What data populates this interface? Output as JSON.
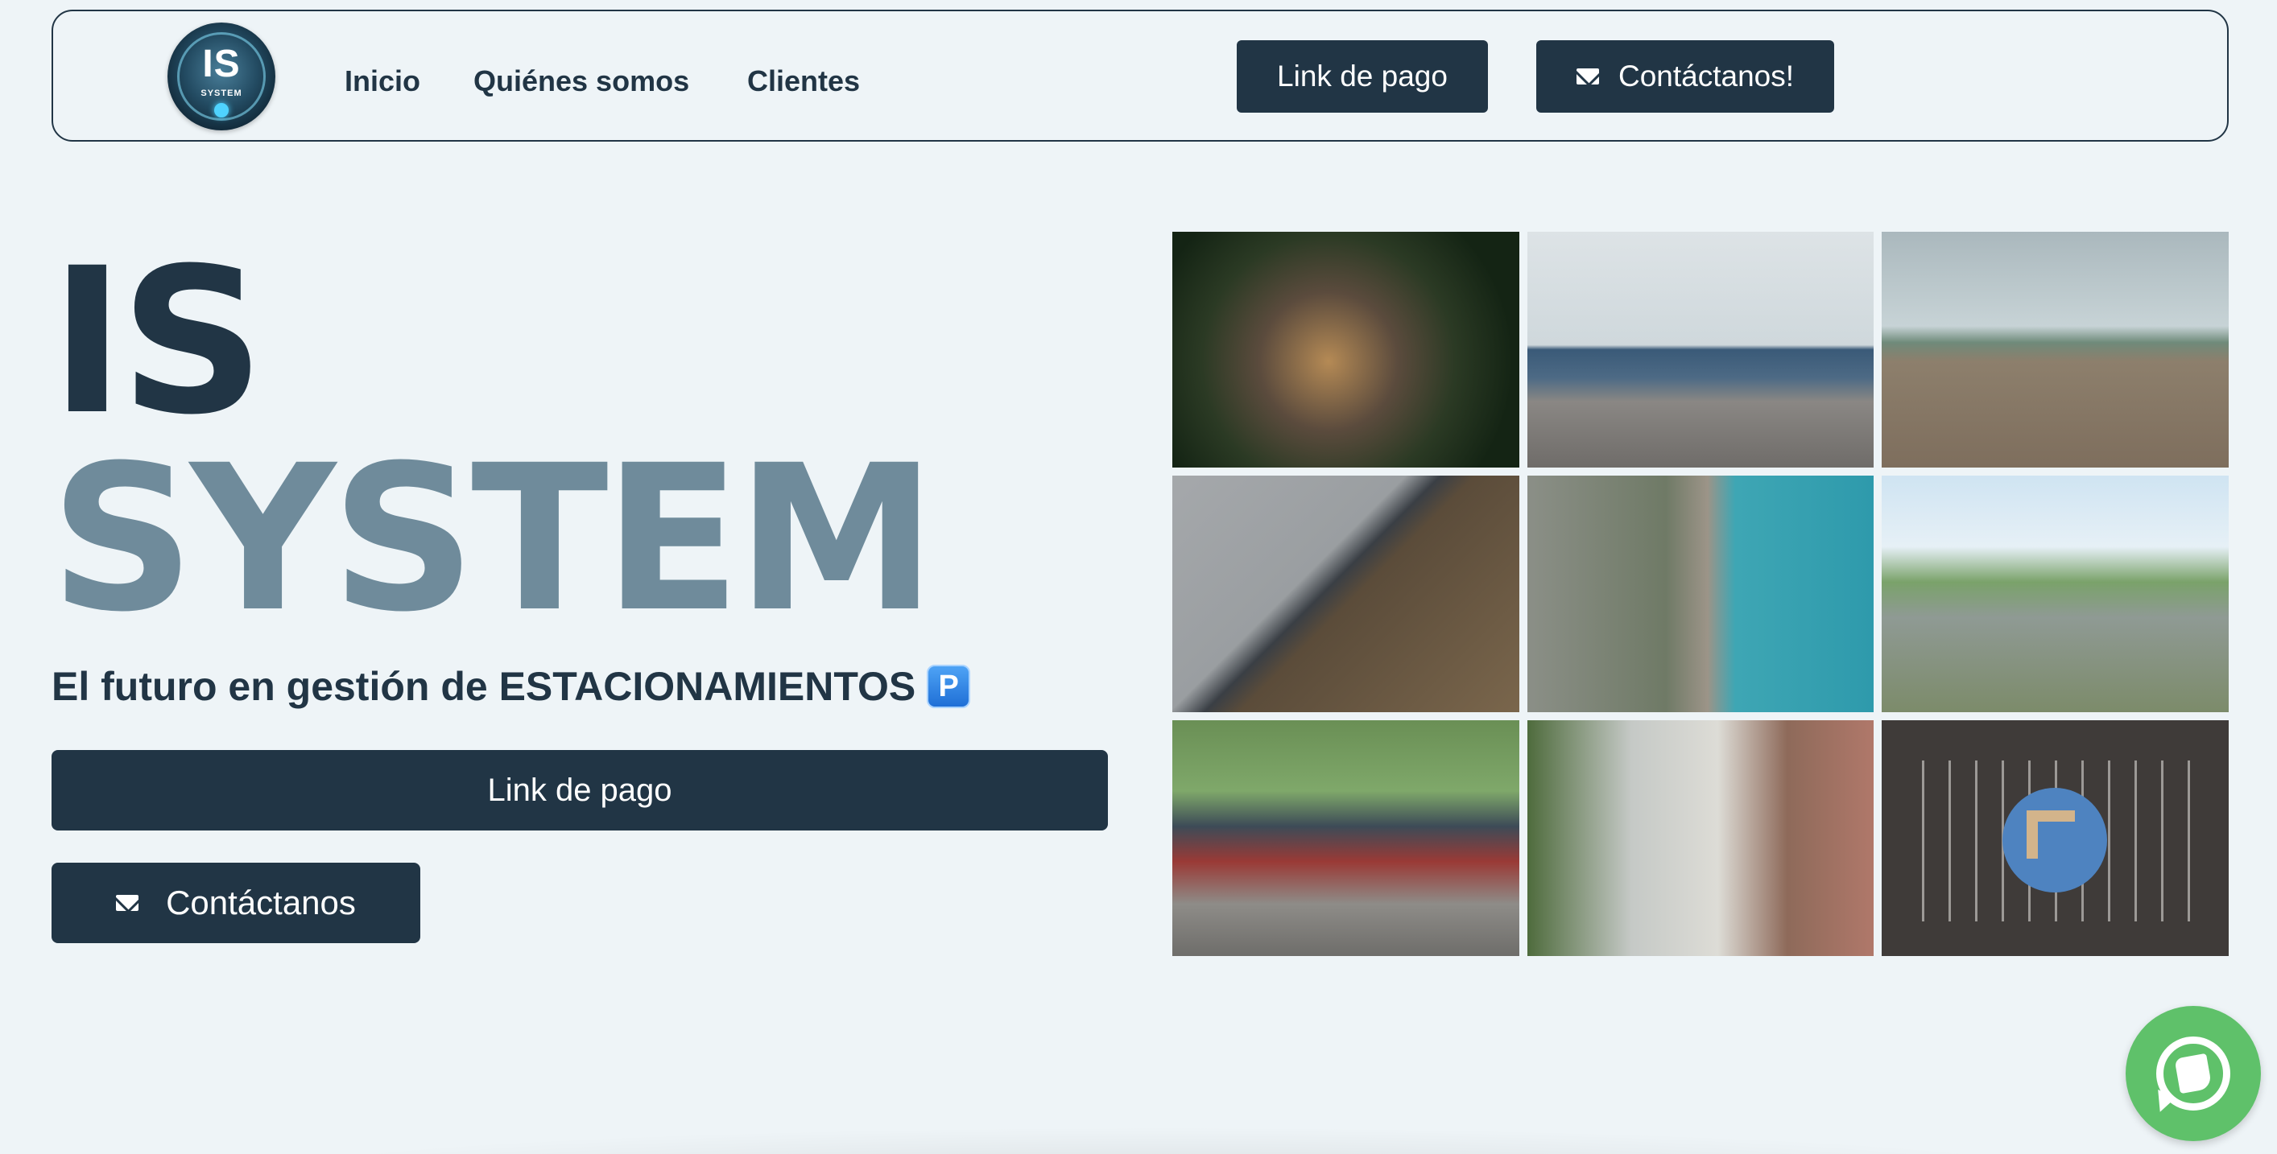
{
  "navbar": {
    "logo": {
      "title": "IS",
      "subtitle": "SYSTEM"
    },
    "links": [
      "Inicio",
      "Quiénes somos",
      "Clientes"
    ],
    "pay_label": "Link de pago",
    "contact_label": "Contáctanos!"
  },
  "hero": {
    "title_line1": "IS",
    "title_line2": "SYSTEM",
    "tagline": "El futuro en gestión de ESTACIONAMIENTOS",
    "tagline_icon": "P",
    "pay_label": "Link de pago",
    "contact_label": "Contáctanos"
  },
  "gallery": {
    "photos": [
      "parking-lot-aerial-night",
      "seaside-parking",
      "empty-beach-parking",
      "diagonal-parking-aerial",
      "coastal-parking-aerial",
      "resort-parking",
      "street-parked-cars",
      "residential-street",
      "parking-lot-arrow"
    ]
  },
  "icons": {
    "mail": "envelope-icon",
    "whatsapp": "whatsapp-icon",
    "parking": "parking-sign-icon"
  },
  "colors": {
    "background": "#eef4f7",
    "primary": "#213545",
    "secondary": "#6f8b9b",
    "whatsapp": "#5fc16a"
  }
}
